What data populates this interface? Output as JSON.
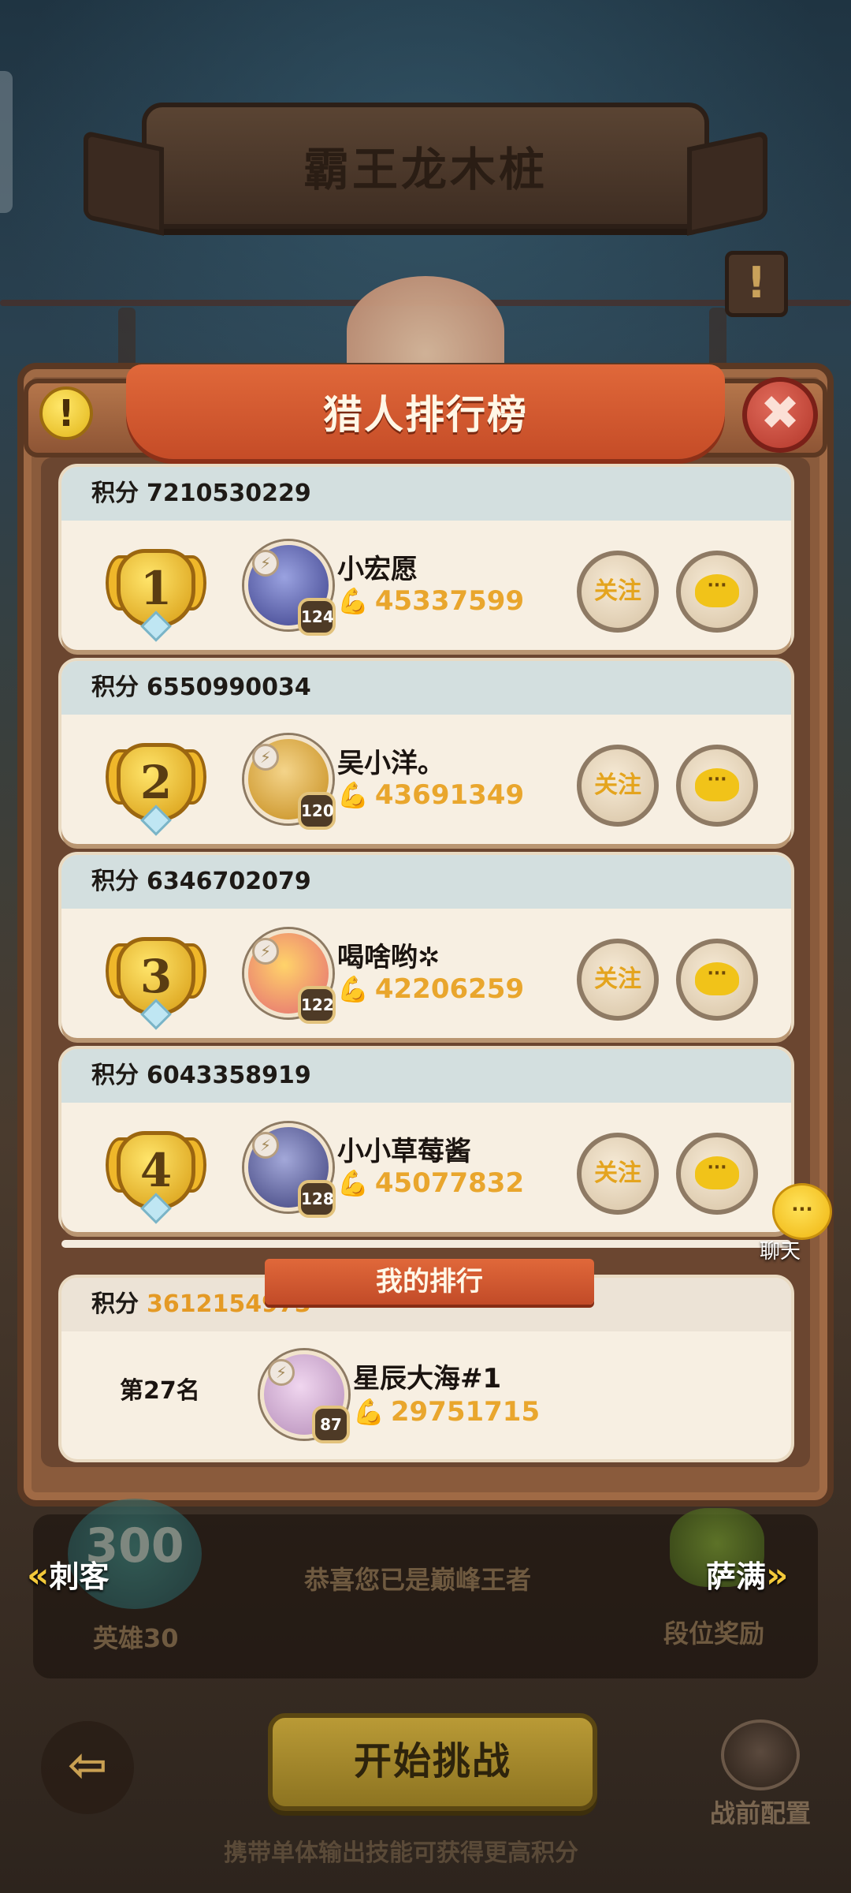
{
  "header": {
    "title": "霸王龙木桩"
  },
  "panel": {
    "title": "猎人排行榜",
    "info_icon": "!",
    "close_icon": "✖"
  },
  "labels": {
    "score": "积分",
    "follow": "关注",
    "chat_glyph": "···"
  },
  "ranking": [
    {
      "rank": "1",
      "score": "7210530229",
      "name": "小宏愿",
      "level": "124",
      "power": "45337599",
      "avatar_color": "#3b3f8a"
    },
    {
      "rank": "2",
      "score": "6550990034",
      "name": "吴小洋。",
      "level": "120",
      "power": "43691349",
      "avatar_color": "#c58b1a"
    },
    {
      "rank": "3",
      "score": "6346702079",
      "name": "喝啥哟✲",
      "level": "122",
      "power": "42206259",
      "avatar_color": "#e46a73"
    },
    {
      "rank": "4",
      "score": "6043358919",
      "name": "小小草莓酱",
      "level": "128",
      "power": "45077832",
      "avatar_color": "#3c3f7a"
    }
  ],
  "my_rank": {
    "title": "我的排行",
    "score": "3612154973",
    "rank_text": "第27名",
    "name": "星辰大海#1",
    "level": "87",
    "power": "29751715",
    "avatar_color": "#b48cb8"
  },
  "float_chat": {
    "label": "聊天",
    "glyph": "···"
  },
  "bottom": {
    "left_badge_number": "300",
    "left_nav": "刺客",
    "right_nav": "萨满",
    "congrats": "恭喜您已是巅峰王者",
    "hero_label": "英雄30",
    "rank_reward": "段位奖励",
    "back_glyph": "⇦",
    "start": "开始挑战",
    "pre_config": "战前配置",
    "hint": "携带单体输出技能可获得更高积分"
  },
  "colors": {
    "accent_gold": "#e9a62d",
    "ribbon_red": "#c54c27",
    "card_bg": "#f7efe2"
  }
}
